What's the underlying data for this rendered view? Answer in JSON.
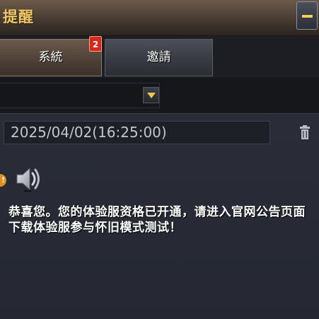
{
  "window": {
    "title": "提醒",
    "minimize_icon": "minimize-icon"
  },
  "tabs": [
    {
      "label": "系統",
      "badge": "2",
      "active": true
    },
    {
      "label": "邀請",
      "active": false
    }
  ],
  "filter": {
    "selected": "",
    "dropdown_icon": "caret-down-icon"
  },
  "message": {
    "timestamp": "2025/04/02(16:25:00)",
    "delete_icon": "trash-icon",
    "unread_marker": "!",
    "type_icon": "speaker-icon",
    "body": "恭喜您。您的体验服资格已开通，请进入官网公告页面下载体验服参与怀旧模式测试！"
  },
  "colors": {
    "title": "#f0c766",
    "accent_yellow": "#f4cf55",
    "badge": "#d8271b",
    "unread": "#e1901f"
  }
}
